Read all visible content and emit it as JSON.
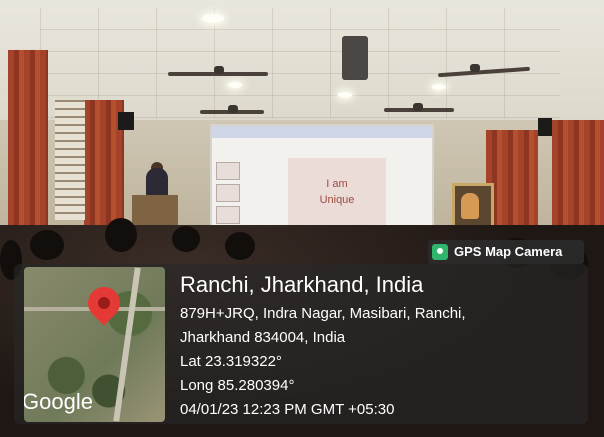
{
  "overlay": {
    "badge_label": "GPS Map Camera",
    "city": "Ranchi, Jharkhand, India",
    "address_line_1": "879H+JRQ, Indra Nagar, Masibari, Ranchi,",
    "address_line_2": "Jharkhand 834004, India",
    "latitude": "Lat 23.319322°",
    "longitude": "Long 85.280394°",
    "timestamp": "04/01/23 12:23 PM GMT +05:30",
    "map_logo": "Google"
  },
  "slide": {
    "line_1": "I am",
    "line_2": "Unique"
  },
  "colors": {
    "pin": "#e53935",
    "badge_icon": "#2fb66b",
    "curtain": "#a5432a"
  },
  "icons": {
    "badge": "gps-map-camera-icon",
    "pin": "map-pin-icon"
  }
}
